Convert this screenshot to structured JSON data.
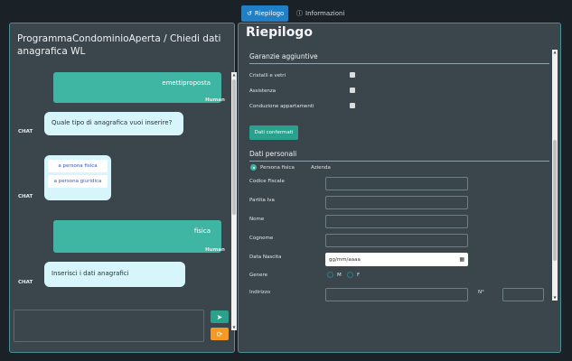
{
  "tabs": [
    {
      "label": "Riepilogo",
      "icon": "history-icon"
    },
    {
      "label": "Informazioni",
      "icon": "info-icon"
    }
  ],
  "left": {
    "title": "ProgrammaCondominioAperta / Chiedi dati anagrafica WL",
    "messages": [
      {
        "from": "human",
        "text": "emettiproposta",
        "label": "Human"
      },
      {
        "from": "chat",
        "text": "Quale tipo di anagrafica vuoi inserire?",
        "label": "CHAT"
      },
      {
        "from": "chat_options",
        "label": "CHAT",
        "options": [
          "a persona fisica",
          "a persona giuridica"
        ]
      },
      {
        "from": "human",
        "text": "fisica",
        "label": "Human"
      },
      {
        "from": "chat",
        "text": "Inserisci i dati anagrafici",
        "label": "CHAT"
      }
    ],
    "send_icon": "send-icon",
    "refresh_icon": "refresh-icon"
  },
  "right": {
    "title": "Riepilogo",
    "garanzie": {
      "heading": "Garanzie aggiuntive",
      "items": [
        "Cristalli e vetri",
        "Assistenza",
        "Conduzione appartamenti"
      ],
      "confirm_label": "Dati confermati"
    },
    "personali": {
      "heading": "Dati personali",
      "type_options": [
        "Persona fisica",
        "Azienda"
      ],
      "selected_type": "Persona fisica",
      "fields": [
        "Codice Fiscale",
        "Partita Iva",
        "Nome",
        "Cognome",
        "Data Nascita",
        "Genere",
        "Indirizzo"
      ],
      "date_placeholder": "gg/mm/aaaa",
      "genere_options": [
        "M",
        "F"
      ],
      "numero_label": "N°"
    }
  }
}
